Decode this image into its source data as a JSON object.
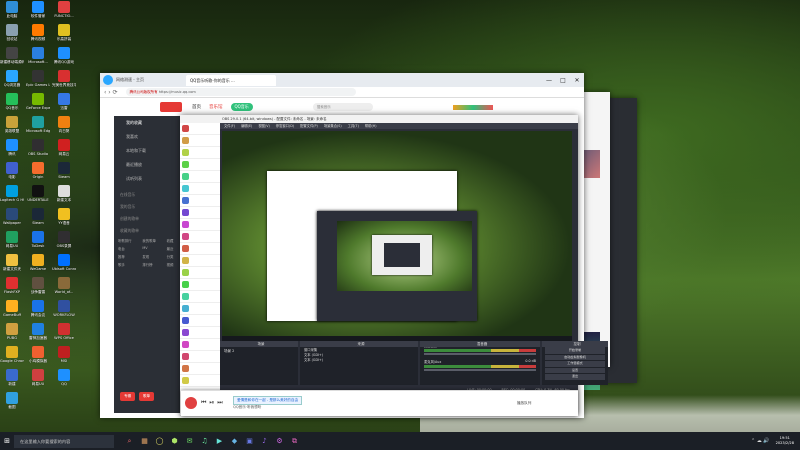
{
  "desktop_icons": [
    {
      "label": "此电脑",
      "color": "#2f8fd8"
    },
    {
      "label": "软件管家",
      "color": "#1e90ff"
    },
    {
      "label": "FUNCTIO...",
      "color": "#e04040"
    },
    {
      "label": "回收站",
      "color": "#8aa0b0"
    },
    {
      "label": "腾讯视频",
      "color": "#ff7a00"
    },
    {
      "label": "乐高拼装",
      "color": "#e0c020"
    },
    {
      "label": "新建移动端源码",
      "color": "#444"
    },
    {
      "label": "Microsoft...",
      "color": "#2a7fe0"
    },
    {
      "label": "腾讯QQ游戏",
      "color": "#1e90ff"
    },
    {
      "label": "QQ浏览器",
      "color": "#2aa7ff"
    },
    {
      "label": "Epic Games Launcher",
      "color": "#333"
    },
    {
      "label": "完美世界竞技平台",
      "color": "#d83030"
    },
    {
      "label": "QQ音乐",
      "color": "#25c05a"
    },
    {
      "label": "GeForce Experience",
      "color": "#76b900"
    },
    {
      "label": "迅雷",
      "color": "#3578e5"
    },
    {
      "label": "英雄联盟",
      "color": "#c9a23a"
    },
    {
      "label": "Microsoft Edge",
      "color": "#1fa0a0"
    },
    {
      "label": "向日葵",
      "color": "#f08010"
    },
    {
      "label": "腾讯",
      "color": "#1e90ff"
    },
    {
      "label": "OBS Studio",
      "color": "#302e31"
    },
    {
      "label": "网易云",
      "color": "#d02020"
    },
    {
      "label": "电影",
      "color": "#4060d0"
    },
    {
      "label": "Origin",
      "color": "#f56c2d"
    },
    {
      "label": "Steam",
      "color": "#1b2838"
    },
    {
      "label": "Logitech G HUB",
      "color": "#00a0e0"
    },
    {
      "label": "UNDERTALE",
      "color": "#111"
    },
    {
      "label": "新建文本",
      "color": "#ddd"
    },
    {
      "label": "Wallpaper",
      "color": "#2a4a7a"
    },
    {
      "label": "Steam",
      "color": "#1b2838"
    },
    {
      "label": "YY语音",
      "color": "#f0c020"
    },
    {
      "label": "网易UU",
      "color": "#20a060"
    },
    {
      "label": "ToDesk",
      "color": "#1a73e8"
    },
    {
      "label": "OBS录屏",
      "color": "#302e31"
    },
    {
      "label": "新建文件夹",
      "color": "#f0c040"
    },
    {
      "label": "WeGame",
      "color": "#f0b020"
    },
    {
      "label": "Ubisoft Connect",
      "color": "#0070ff"
    },
    {
      "label": "FlashFXP",
      "color": "#e03030"
    },
    {
      "label": "战争雷霆",
      "color": "#605040"
    },
    {
      "label": "World_of...",
      "color": "#8a6a3a"
    },
    {
      "label": "GameBuff",
      "color": "#ffb020"
    },
    {
      "label": "腾讯会议",
      "color": "#1a73e8"
    },
    {
      "label": "WORKFLOW",
      "color": "#3050a0"
    },
    {
      "label": "PUBG",
      "color": "#d0a040"
    },
    {
      "label": "雷神加速器",
      "color": "#2080e0"
    },
    {
      "label": "WPS Office",
      "color": "#d03030"
    },
    {
      "label": "Google Chrome",
      "color": "#e0b020"
    },
    {
      "label": "小鸡模拟器",
      "color": "#f06030"
    },
    {
      "label": "MSI",
      "color": "#c02020"
    },
    {
      "label": "新建",
      "color": "#3a6acc"
    },
    {
      "label": "网易UU",
      "color": "#d04040"
    },
    {
      "label": "QQ",
      "color": "#1e90ff"
    },
    {
      "label": "截图",
      "color": "#30a0e0"
    }
  ],
  "browser": {
    "tab1": "网络测速 - 主页",
    "tab2": "QQ音乐听歌-你的音乐 ...",
    "url": "https://music.qq.com",
    "url_prefix": "腾讯公司版权所有",
    "logo": "QQ音乐",
    "nav": [
      "首页",
      "音乐馆",
      "我的音乐"
    ],
    "search_placeholder": "搜索音乐",
    "sidebar": [
      "我的收藏",
      "我喜欢",
      "本地和下载",
      "最近播放",
      "试听列表"
    ],
    "side_sections": [
      "在线音乐",
      "我的音乐",
      "创建的歌单",
      "收藏的歌单"
    ],
    "sidebar_cells": [
      "听歌排行",
      "我的歌单",
      "收藏",
      "电台",
      "MV",
      "最近",
      "推荐",
      "发现",
      "分类",
      "歌手",
      "排行榜",
      "视频"
    ],
    "footer_btns": [
      "专辑",
      "歌单"
    ],
    "win_ctrl": [
      "—",
      "□",
      "✕"
    ]
  },
  "obs": {
    "title": "OBS 29.0.1 (64-bit, windows) - 配置文件: 未命名 - 场景: 未命名",
    "menu": [
      "文件(F)",
      "编辑(E)",
      "视图(V)",
      "停靠窗口(D)",
      "配置文件(P)",
      "场景集合(S)",
      "工具(T)",
      "帮助(H)"
    ],
    "docks": {
      "scenes": "场景",
      "sources": "来源",
      "mixer": "混音器",
      "transitions": "转场特效",
      "controls": "控制"
    },
    "scene_item": "场景 2",
    "source_items": [
      "显示器采集",
      "窗口采集",
      "文本 (GDI+)",
      "文本 (GDI+)"
    ],
    "mixer_items": [
      {
        "name": "桌面音频",
        "db": "0.0 dB"
      },
      {
        "name": "麦克风/Aux",
        "db": "0.0 dB"
      }
    ],
    "controls": [
      "开始直播",
      "开始录制",
      "启动虚拟摄像机",
      "工作室模式",
      "设置",
      "退出"
    ],
    "transition_name": "淡入淡出",
    "duration_label": "时长",
    "duration": "300 ms",
    "status": [
      "LIVE: 00:00:00",
      "REC: 00:00:00",
      "CPU: 0.3%, 60.00 fps"
    ]
  },
  "qqmusic_player": {
    "song": "爱情是和你在一起 - 是那么美好的自由",
    "status": "QQ音乐·听我想听",
    "controls": [
      "⏮",
      "⏯",
      "⏭"
    ],
    "right_btn": "播放队列"
  },
  "taskbar": {
    "search_placeholder": "在这里输入你要搜索的内容",
    "time": "19:51",
    "date": "2023/2/28",
    "apps": [
      "⌕",
      "▦",
      "◯",
      "⬢",
      "✉",
      "♫",
      "▶",
      "◆",
      "▣",
      "♪",
      "⚙",
      "⧉"
    ]
  },
  "notes": {
    "warning": "此窗口包含从未连接完成的内容... 显示内容请重新"
  }
}
